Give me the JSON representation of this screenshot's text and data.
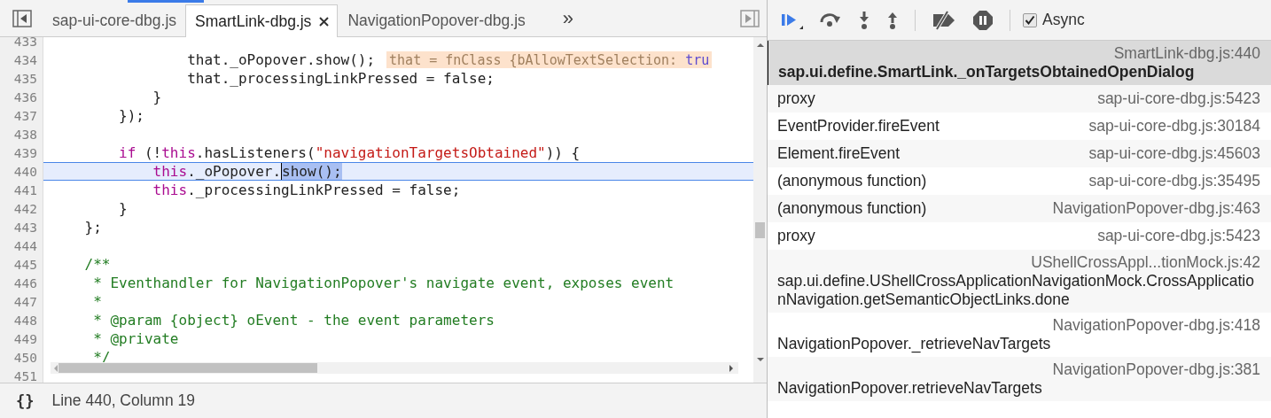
{
  "editor": {
    "tabs": [
      {
        "label": "sap-ui-core-dbg.js",
        "selected": false
      },
      {
        "label": "SmartLink-dbg.js",
        "selected": true
      },
      {
        "label": "NavigationPopover-dbg.js",
        "selected": false
      }
    ],
    "more_tabs": "»",
    "lines": [
      {
        "number": "433",
        "current": false
      },
      {
        "number": "434",
        "current": false,
        "tokens": [
          {
            "text": "                that._oPopover.show();",
            "kind": "plain"
          }
        ],
        "annotation": [
          {
            "text": "that = fnClass {bAllowTextSelection: ",
            "kind": "plain"
          },
          {
            "text": "tru",
            "kind": "literal"
          }
        ]
      },
      {
        "number": "435",
        "current": false,
        "tokens": [
          {
            "text": "                that._processingLinkPressed = false;",
            "kind": "plain"
          }
        ]
      },
      {
        "number": "436",
        "current": false,
        "tokens": [
          {
            "text": "            }",
            "kind": "plain"
          }
        ]
      },
      {
        "number": "437",
        "current": false,
        "tokens": [
          {
            "text": "        });",
            "kind": "plain"
          }
        ]
      },
      {
        "number": "438",
        "current": false
      },
      {
        "number": "439",
        "current": false,
        "tokens": [
          {
            "text": "        if",
            "kind": "keyword"
          },
          {
            "text": " (!",
            "kind": "plain"
          },
          {
            "text": "this",
            "kind": "keyword"
          },
          {
            "text": ".hasListeners(",
            "kind": "plain"
          },
          {
            "text": "\"navigationTargetsObtained\"",
            "kind": "string"
          },
          {
            "text": ")) {",
            "kind": "plain"
          }
        ]
      },
      {
        "number": "440",
        "current": true,
        "tokens": [
          {
            "text": "            this",
            "kind": "keyword"
          },
          {
            "text": "._oPopover.",
            "kind": "plain"
          },
          {
            "text": "show();",
            "kind": "selection"
          }
        ]
      },
      {
        "number": "441",
        "current": false,
        "tokens": [
          {
            "text": "            this",
            "kind": "keyword"
          },
          {
            "text": "._processingLinkPressed = false;",
            "kind": "plain"
          }
        ]
      },
      {
        "number": "442",
        "current": false,
        "tokens": [
          {
            "text": "        }",
            "kind": "plain"
          }
        ]
      },
      {
        "number": "443",
        "current": false,
        "tokens": [
          {
            "text": "    };",
            "kind": "plain"
          }
        ]
      },
      {
        "number": "444",
        "current": false
      },
      {
        "number": "445",
        "current": false,
        "tokens": [
          {
            "text": "    /**",
            "kind": "comment"
          }
        ]
      },
      {
        "number": "446",
        "current": false,
        "tokens": [
          {
            "text": "     * Eventhandler for NavigationPopover's navigate event, exposes event",
            "kind": "comment"
          }
        ]
      },
      {
        "number": "447",
        "current": false,
        "tokens": [
          {
            "text": "     *",
            "kind": "comment"
          }
        ]
      },
      {
        "number": "448",
        "current": false,
        "tokens": [
          {
            "text": "     * @param {object} oEvent - the event parameters",
            "kind": "comment"
          }
        ]
      },
      {
        "number": "449",
        "current": false,
        "tokens": [
          {
            "text": "     * @private",
            "kind": "comment"
          }
        ]
      },
      {
        "number": "450",
        "current": false,
        "tokens": [
          {
            "text": "     */",
            "kind": "comment"
          }
        ]
      },
      {
        "number": "451",
        "current": false
      }
    ],
    "status": {
      "pretty_print": "{}",
      "position": "Line 440, Column 19"
    }
  },
  "debugger": {
    "async": {
      "label": "Async",
      "checked": true
    },
    "call_stack": [
      {
        "function": "sap.ui.define.SmartLink._onTargetsObtainedOpenDialog",
        "location": "SmartLink-dbg.js:440",
        "selected": true,
        "kind": "stacked"
      },
      {
        "function": "proxy",
        "location": "sap-ui-core-dbg.js:5423",
        "selected": false,
        "kind": "inline"
      },
      {
        "function": "EventProvider.fireEvent",
        "location": "sap-ui-core-dbg.js:30184",
        "selected": false,
        "kind": "inline"
      },
      {
        "function": "Element.fireEvent",
        "location": "sap-ui-core-dbg.js:45603",
        "selected": false,
        "kind": "inline"
      },
      {
        "function": "(anonymous function)",
        "location": "sap-ui-core-dbg.js:35495",
        "selected": false,
        "kind": "inline"
      },
      {
        "function": "(anonymous function)",
        "location": "NavigationPopover-dbg.js:463",
        "selected": false,
        "kind": "inline"
      },
      {
        "function": "proxy",
        "location": "sap-ui-core-dbg.js:5423",
        "selected": false,
        "kind": "inline"
      },
      {
        "function": "sap.ui.define.UShellCrossApplicationNavigationMock.CrossApplicationNavigation.getSemanticObjectLinks.done",
        "location": "UShellCrossAppl...tionMock.js:42",
        "selected": false,
        "kind": "stacked"
      },
      {
        "function": "NavigationPopover._retrieveNavTargets",
        "location": "NavigationPopover-dbg.js:418",
        "selected": false,
        "kind": "stacked"
      },
      {
        "function": "NavigationPopover.retrieveNavTargets",
        "location": "NavigationPopover-dbg.js:381",
        "selected": false,
        "kind": "stacked"
      }
    ]
  }
}
